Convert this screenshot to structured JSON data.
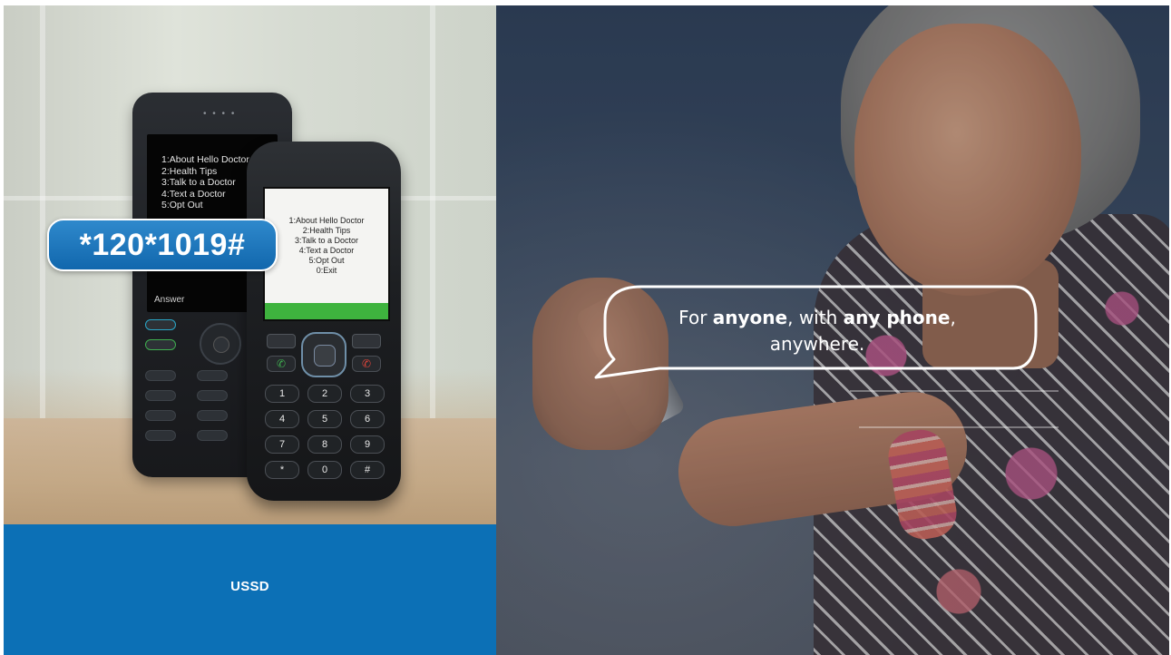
{
  "left_panel": {
    "caption": "USSD",
    "dial_code": "*120*1019#",
    "back_phone": {
      "menu": [
        "1:About Hello Doctor",
        "2:Health Tips",
        "3:Talk to a Doctor",
        "4:Text a Doctor",
        "5:Opt Out"
      ],
      "soft_label": "Answer"
    },
    "front_phone": {
      "menu": [
        "1:About Hello Doctor",
        "2:Health Tips",
        "3:Talk to a Doctor",
        "4:Text a Doctor",
        "5:Opt Out",
        "0:Exit"
      ],
      "keys": [
        [
          "1",
          "2",
          "3"
        ],
        [
          "4",
          "5",
          "6"
        ],
        [
          "7",
          "8",
          "9"
        ],
        [
          "*",
          "0",
          "#"
        ]
      ]
    },
    "accent_color": "#0c70b6"
  },
  "right_panel": {
    "tagline": {
      "part1": "For ",
      "bold1": "anyone",
      "part2": ", with ",
      "bold2": "any phone",
      "part3": ",",
      "line2": "anywhere."
    }
  }
}
